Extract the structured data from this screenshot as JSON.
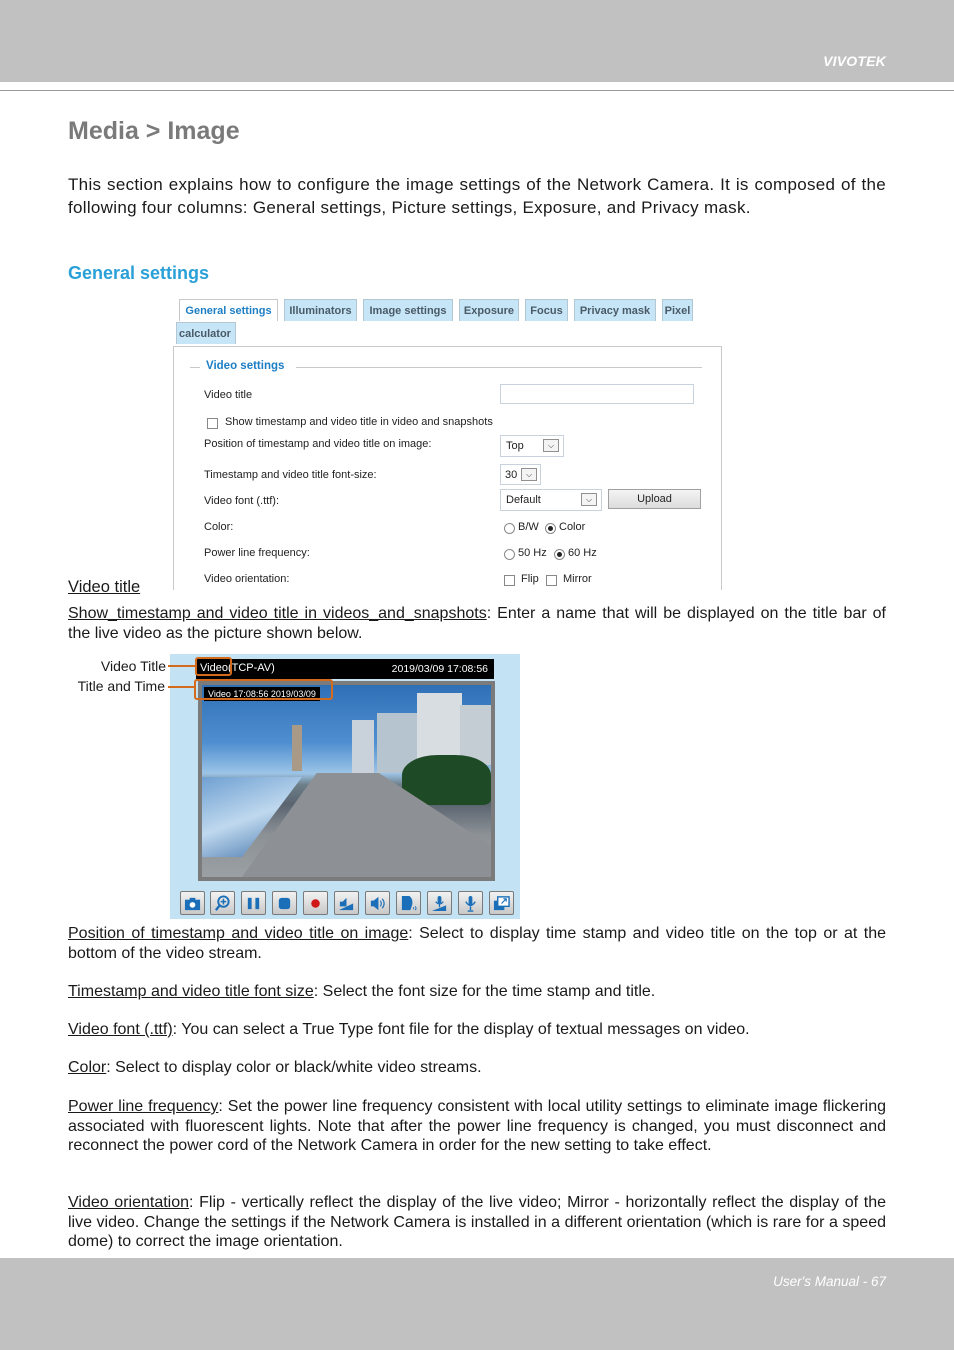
{
  "header": {
    "brand": "VIVOTEK"
  },
  "footer": {
    "page_label": "User's Manual - 67"
  },
  "page_title": "Media > Image",
  "intro": "This section explains how to configure the image settings of the Network Camera. It is composed of the following four columns: General settings, Picture settings, Exposure, and Privacy mask.",
  "section_heading": "General settings",
  "settings_ui": {
    "tabs": [
      {
        "label": "General settings",
        "active": true
      },
      {
        "label": "Illuminators"
      },
      {
        "label": "Image settings"
      },
      {
        "label": "Exposure"
      },
      {
        "label": "Focus"
      },
      {
        "label": "Privacy mask"
      },
      {
        "label": "Pixel"
      },
      {
        "label": "calculator"
      }
    ],
    "fieldset_legend": "Video settings",
    "video_title": {
      "label": "Video title",
      "value": ""
    },
    "show_timestamp": {
      "label": "Show timestamp and video title in video and snapshots",
      "checked": false
    },
    "position": {
      "label": "Position of timestamp and video title on image:",
      "value": "Top"
    },
    "font_size": {
      "label": "Timestamp and video title font-size:",
      "value": "30"
    },
    "video_font": {
      "label": "Video font (.ttf):",
      "value": "Default",
      "upload_label": "Upload"
    },
    "color": {
      "label": "Color:",
      "options": [
        "B/W",
        "Color"
      ],
      "selected": "Color"
    },
    "power_line": {
      "label": "Power line frequency:",
      "options": [
        "50 Hz",
        "60 Hz"
      ],
      "selected": "60 Hz"
    },
    "orientation": {
      "label": "Video orientation:",
      "options": [
        "Flip",
        "Mirror"
      ],
      "flip": false,
      "mirror": false
    }
  },
  "video_title_heading": "Video title",
  "show_ts_para": {
    "term": "Show_timestamp and video title in videos_and_snapshots",
    "text": ": Enter a name that will be displayed on the title bar of the live video as the picture shown below."
  },
  "video_preview": {
    "callouts": {
      "video_title": "Video Title",
      "title_and_time": "Title and Time"
    },
    "title_bar_title": "Video",
    "title_bar_suffix": "(TCP-AV)",
    "title_bar_time": "2019/03/09  17:08:56",
    "overlay_text": "Video 17:08:56  2019/03/09",
    "controls": [
      "snapshot-icon",
      "digital-zoom-icon",
      "pause-icon",
      "stop-icon",
      "record-icon",
      "volume-mute-icon",
      "volume-icon",
      "talk-icon",
      "mic-mute-icon",
      "microphone-icon",
      "fullscreen-icon"
    ]
  },
  "descriptions": [
    {
      "term": "Position of timestamp and video title on image",
      "text": ": Select to display time stamp and video title on the top or at the bottom of the video stream."
    },
    {
      "term": "Timestamp and video title font size",
      "text": ": Select the font size for the time stamp and title."
    },
    {
      "term": "Video font (.ttf)",
      "text": ": You can select a True Type font file for the display of textual messages on video."
    },
    {
      "term": "Color",
      "text": ": Select to display color or black/white video streams."
    },
    {
      "term": "Power line frequency",
      "text": ": Set the power line frequency consistent with local utility settings to eliminate image flickering associated with fluorescent lights. Note that after the power line frequency is changed, you must disconnect and reconnect the power cord of the Network Camera in order for the new setting to take effect."
    },
    {
      "term": "Video orientation",
      "text": ": Flip - vertically reflect the display of the live video; Mirror - horizontally reflect the display of the live video. Change the settings if the Network Camera is installed in a different orientation (which is rare for a speed dome) to correct the image orientation."
    }
  ]
}
